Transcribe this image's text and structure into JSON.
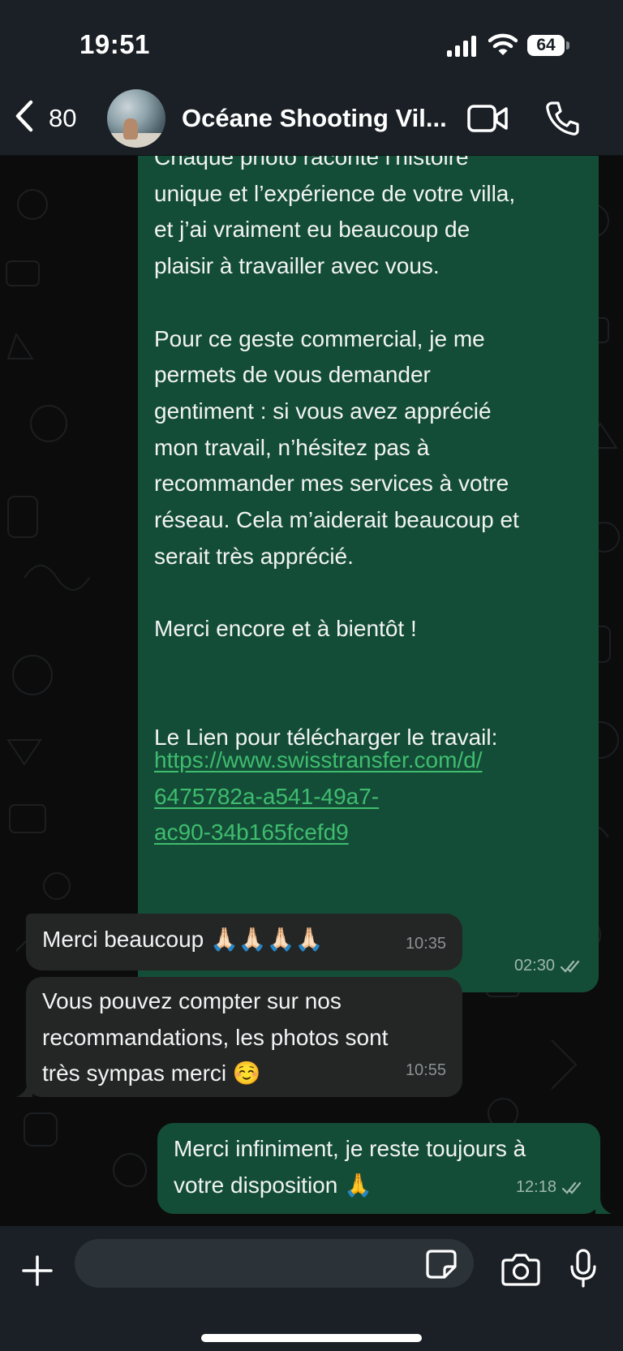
{
  "status_bar": {
    "time": "19:51",
    "battery_percent": "64"
  },
  "header": {
    "back_count": "80",
    "contact_name": "Océane Shooting Vil..."
  },
  "messages": [
    {
      "direction": "outgoing",
      "text": "Chaque photo raconte l’histoire\nunique et l’expérience de votre villa,\net j’ai vraiment eu beaucoup de\nplaisir à travailler avec vous.\n\nPour ce geste commercial, je me\npermets de vous demander\ngentiment : si vous avez apprécié\nmon travail, n’hésitez pas à\nrecommander mes services à votre\nréseau. Cela m’aiderait beaucoup et\nserait très apprécié.\n\nMerci encore et à bientôt !\n\n\nLe Lien pour télécharger le travail:",
      "link": "https://www.swisstransfer.com/d/\n6475782a-a541-49a7-\nac90-34b165fcefd9",
      "time": "02:30",
      "status": "read"
    },
    {
      "direction": "incoming",
      "text": "Merci beaucoup 🙏🏻🙏🏻🙏🏻🙏🏻",
      "time": "10:35"
    },
    {
      "direction": "incoming",
      "text": "Vous pouvez compter sur nos\nrecommandations, les photos sont\ntrès sympas merci ☺️",
      "time": "10:55"
    },
    {
      "direction": "outgoing",
      "text": "Merci infiniment, je reste toujours à\nvotre disposition 🙏",
      "time": "12:18",
      "status": "read"
    }
  ],
  "composer": {
    "value": "",
    "placeholder": ""
  },
  "colors": {
    "header_bg": "#1b2026",
    "outgoing_bubble": "#144d37",
    "incoming_bubble": "#242626",
    "link": "#3fbd6f"
  },
  "icons": {
    "back": "chevron-left-icon",
    "video": "video-camera-icon",
    "call": "phone-icon",
    "attach": "plus-icon",
    "sticker": "sticker-icon",
    "camera": "camera-icon",
    "mic": "microphone-icon"
  }
}
